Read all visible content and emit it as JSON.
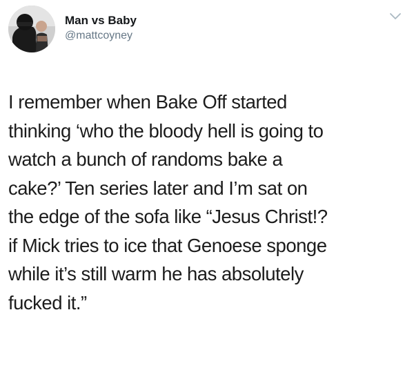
{
  "tweet": {
    "display_name": "Man vs Baby",
    "handle": "@mattcoyney",
    "avatar_icon": "user-avatar-photo",
    "menu_icon": "chevron-down-icon",
    "text": "I remember when Bake Off started\nthinking ‘who the bloody hell is going to\nwatch a bunch of randoms bake a\ncake?’ Ten series later and I’m sat on\nthe edge of the sofa like “Jesus Christ!?\nif Mick tries to ice that Genoese sponge\nwhile it’s still warm he has absolutely\nfucked it.”"
  },
  "colors": {
    "background": "#ffffff",
    "text": "#14171a",
    "secondary_text": "#657786",
    "chevron": "#aab8c2"
  }
}
